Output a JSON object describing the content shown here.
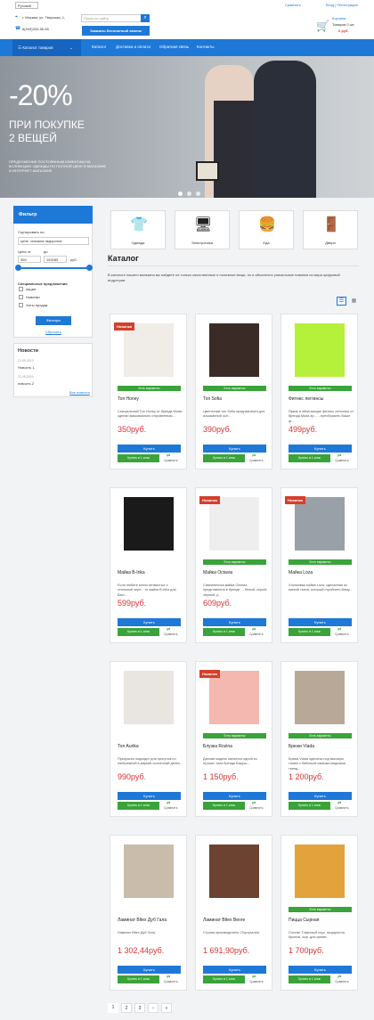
{
  "header": {
    "language": "Русский",
    "compare_link": "Сравнить",
    "login_link": "Вход",
    "register_link": "Регистрация",
    "address": "г. Москва, ул. Тверская, 1,",
    "phone": "8(333)333-55-55",
    "search_placeholder": "Поиск по сайту",
    "call_button": "Заказать бесплатный звонок",
    "cart": {
      "title": "Корзина",
      "count": "Товаров 0 шт.",
      "sum": "0 руб."
    }
  },
  "nav": {
    "catalog_button": "Каталог товаров",
    "items": [
      "Каталог",
      "Доставка и оплата",
      "Обратная связь",
      "Контакты"
    ]
  },
  "hero": {
    "big": "-20%",
    "line1": "ПРИ ПОКУПКЕ",
    "line2": "2 ВЕЩЕЙ",
    "small": "ПРЕДЛОЖЕНИЕ ПОСТОЯННЫМ КЛИЕНТАМ НА КОЛЛЕКЦИЮ ОДЕЖДЫ ПО ПОЛНОЙ ЦЕНЕ В МАГАЗИНЕ И ИНТЕРНЕТ-МАГАЗИНЕ"
  },
  "filter": {
    "title": "Фильтр",
    "sort_label": "Сортировать по:",
    "sort_value": "цене, сначала недорогие",
    "price_from_label": "Цена от",
    "price_to_label": "до",
    "price_from": "350",
    "price_to": "153285",
    "currency": "руб.",
    "special_title": "Специальные предложения",
    "specials": [
      "Акции",
      "Новинки",
      "Хиты продаж"
    ],
    "apply_button": "Фильтры",
    "reset_link": "Сбросить"
  },
  "news": {
    "title": "Новости",
    "items": [
      {
        "date": "21.05.2019",
        "title": "Новость 1"
      },
      {
        "date": "21.05.2019",
        "title": "новость 2"
      }
    ],
    "all_link": "Все новости"
  },
  "categories": [
    {
      "label": "Одежда",
      "icon": "clothes-icon"
    },
    {
      "label": "Электроника",
      "icon": "electronics-icon"
    },
    {
      "label": "Еда",
      "icon": "food-icon"
    },
    {
      "label": "Двери",
      "icon": "door-icon"
    }
  ],
  "catalog": {
    "title": "Каталог",
    "description": "В каталоге нашего магазина вы найдете не только качественные и полезные вещи, но и абсолютно уникальные новинки из мира цифровой индустрии."
  },
  "product_labels": {
    "variants": "Есть варианты",
    "buy": "Купить",
    "one_click": "Купить в 1 клик",
    "compare": "Сравнить",
    "new_badge": "Новинка"
  },
  "products": [
    {
      "name": "Топ Honey",
      "desc": "Сексуальный Топ Honey от бренда Moda сделан максимально откровенным...",
      "price": "350руб.",
      "badge": "Новинка",
      "variants": true,
      "img_color": "#f0ece8"
    },
    {
      "name": "Топ Sofia",
      "desc": "Цветочный топ Sofia предназначен для изысканной осе...",
      "price": "390руб.",
      "badge": "",
      "variants": true,
      "img_color": "#3b2b26"
    },
    {
      "name": "Фитнес леггинсы",
      "desc": "Яркие и облегающие фитнес леггинсы от бренда Moda ар... ...преобразить Ваше ф...",
      "price": "499руб.",
      "badge": "",
      "variants": true,
      "img_color": "#b5f03a"
    },
    {
      "name": "Майка B-Irika",
      "desc": "Если любите много ветвистых и стильный черн... то майка B-Irika для Вас!...",
      "price": "599руб.",
      "badge": "",
      "variants": false,
      "img_color": "#1a1a1a"
    },
    {
      "name": "Майка Octavia",
      "desc": "Симпатичная майка Octavia представлена в бренде ... белый, серый, чёрный, р...",
      "price": "609руб.",
      "badge": "Новинка",
      "variants": true,
      "img_color": "#eeeeee"
    },
    {
      "name": "Майка Loza",
      "desc": "Хлопковая майка Loza, сделанная из мягкой ткани, который стройнить Ваму...",
      "price": "",
      "badge": "Новинка",
      "variants": true,
      "img_color": "#9aa0a8"
    },
    {
      "name": "Топ Aurika",
      "desc": "Прекрасно подходит для прогулок по набережной в жаркий солнечный денек...",
      "price": "990руб.",
      "badge": "",
      "variants": false,
      "img_color": "#e9e5e0"
    },
    {
      "name": "Блузка Rozina",
      "desc": "Данная модель является одной из лучших типа бренда Вируш...",
      "price": "1 150руб.",
      "badge": "Новинка",
      "variants": true,
      "img_color": "#f4b8b0"
    },
    {
      "name": "Брюки Vlada",
      "desc": "Брюки Vlada сделаны под высокую талию с бабочкой самыми модными тренд...",
      "price": "1 200руб.",
      "badge": "",
      "variants": true,
      "img_color": "#b8a898"
    },
    {
      "name": "Ламинат Bltex Дуб Гала",
      "desc": "Ламинат Bltex Дуб Гала",
      "price": "1 302,44руб.",
      "badge": "",
      "variants": false,
      "img_color": "#c9bcaa"
    },
    {
      "name": "Ламинат Bltex Венге",
      "desc": "Страна производитель: Португалия.",
      "price": "1 691,90руб.",
      "badge": "",
      "variants": false,
      "img_color": "#6b4330"
    },
    {
      "name": "Пицца Сырная",
      "desc": "Состав: Томатный соус, моцарелла, брынза, сыр. для фанат...",
      "price": "1 700руб.",
      "badge": "",
      "variants": true,
      "img_color": "#e2a23c"
    }
  ],
  "pagination": [
    "1",
    "2",
    "3",
    "›",
    "»"
  ]
}
